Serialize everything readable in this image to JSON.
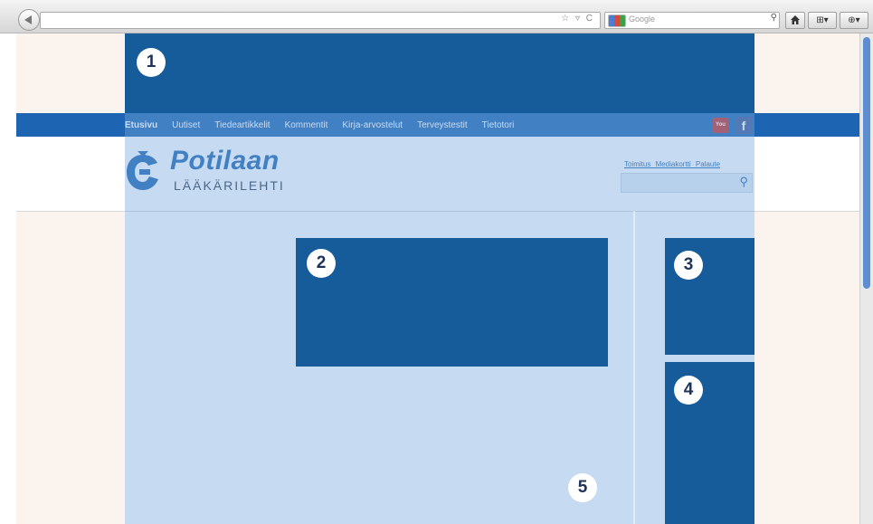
{
  "browser": {
    "search_placeholder": "Google",
    "url_icons": "☆ ▿ C",
    "search_icon": "⚲",
    "home_icon": "home-icon",
    "bookmarks_label": "⊞▾",
    "addon_label": "⊕▾"
  },
  "zones": {
    "one": "1",
    "two": "2",
    "three": "3",
    "four": "4",
    "five": "5"
  },
  "nav": {
    "items": [
      "Etusivu",
      "Uutiset",
      "Tiedeartikkelit",
      "Kommentit",
      "Kirja-arvostelut",
      "Terveystestit",
      "Tietotori"
    ],
    "active_index": 0,
    "youtube_label": "You Tube",
    "facebook_label": "f"
  },
  "header": {
    "logo_title": "Potilaan",
    "logo_subtitle": "LÄÄKÄRILEHTI",
    "utility_links": "Toimitus Mediakortti Palaute",
    "search_icon": "⚲"
  },
  "colors": {
    "accent": "#1d65b2",
    "zone_block": "#175c9a",
    "margin": "#fbf4ee",
    "overlay": "#78a8de"
  }
}
